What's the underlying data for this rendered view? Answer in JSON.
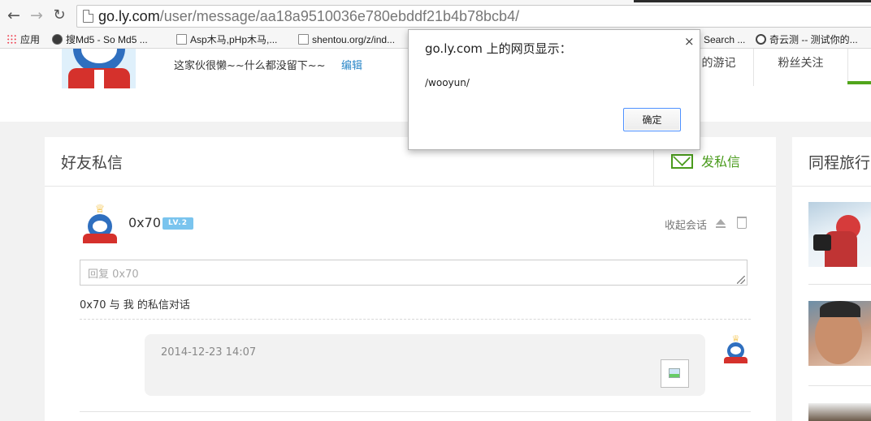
{
  "browser": {
    "url_host": "go.ly.com",
    "url_path": "/user/message/aa18a9510036e780ebddf21b4b78bcb4/",
    "bookmarks": [
      {
        "label": "应用",
        "icon": "apps-icon"
      },
      {
        "label": "搜Md5 - So Md5 ...",
        "icon": "globe-icon"
      },
      {
        "label": "Asp木马,pHp木马,...",
        "icon": "page-icon"
      },
      {
        "label": "shentou.org/z/ind...",
        "icon": "page-icon"
      },
      {
        "label": "Search ...",
        "icon": "page-icon"
      },
      {
        "label": "奇云测 -- 测试你的...",
        "icon": "clock-icon"
      }
    ]
  },
  "profile": {
    "bio": "这家伙很懒~~什么都没留下~~",
    "edit_label": "编辑",
    "tabs": [
      {
        "label": "的游记"
      },
      {
        "label": "粉丝关注"
      }
    ]
  },
  "messages": {
    "title": "好友私信",
    "send_label": "发私信",
    "icons": {
      "send": "envelope-icon",
      "collapse": "triangle-up-icon",
      "delete": "trash-icon"
    },
    "conversation": {
      "user_name": "0x70",
      "level": "LV.2",
      "collapse_label": "收起会话",
      "reply_placeholder": "回复 0x70",
      "title": "0x70 与 我 的私信对话",
      "items": [
        {
          "time": "2014-12-23 14:07"
        }
      ]
    }
  },
  "sidebar": {
    "title": "同程旅行"
  },
  "dialog": {
    "title": "go.ly.com 上的网页显示：",
    "message": "/wooyun/",
    "ok_label": "确定",
    "close_label": "×"
  },
  "colors": {
    "accent_green": "#51a51b",
    "link_blue": "#2b87c8",
    "level_badge": "#7ac4ee"
  }
}
